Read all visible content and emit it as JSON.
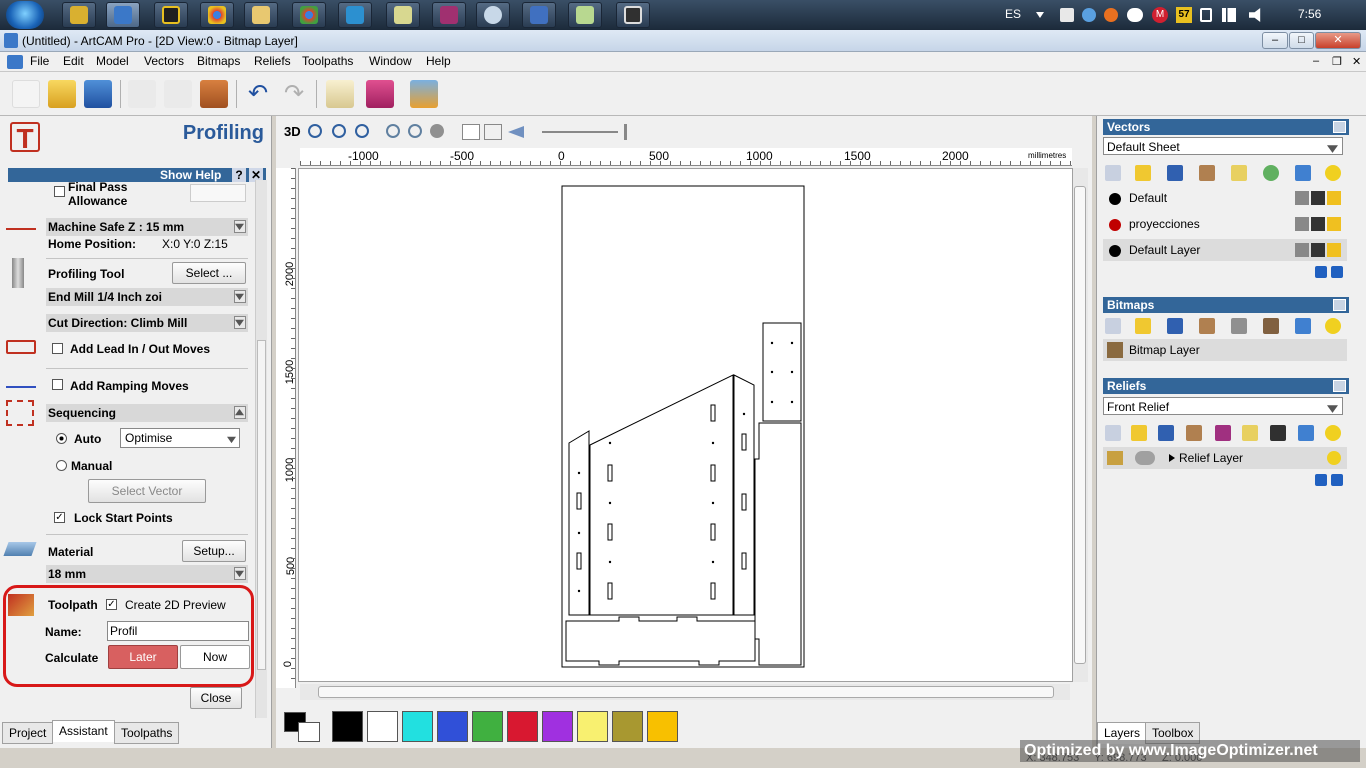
{
  "taskbar": {
    "lang": "ES",
    "clock": "7:56",
    "badge": "57"
  },
  "window": {
    "title": "(Untitled) - ArtCAM Pro - [2D View:0 - Bitmap Layer]",
    "min": "–",
    "max": "□",
    "close": "✕"
  },
  "menu": [
    "File",
    "Edit",
    "Model",
    "Vectors",
    "Bitmaps",
    "Reliefs",
    "Toolpaths",
    "Window",
    "Help"
  ],
  "left": {
    "title": "Profiling",
    "show_help": "Show Help",
    "help_q": "?",
    "help_x": "✕",
    "final_pass": "Final Pass",
    "allowance": "Allowance",
    "safe_z": "Machine Safe Z : 15 mm",
    "home_label": "Home Position:",
    "home_value": "X:0 Y:0 Z:15",
    "tool_label": "Profiling Tool",
    "select_btn": "Select ...",
    "tool_name": "End Mill 1/4 Inch zoi",
    "cut_dir": "Cut Direction: Climb Mill",
    "lead": "Add Lead In / Out Moves",
    "ramp": "Add Ramping Moves",
    "sequencing": "Sequencing",
    "auto": "Auto",
    "optimise": "Optimise",
    "manual": "Manual",
    "select_vector": "Select Vector",
    "lock_start": "Lock Start Points",
    "material": "Material",
    "setup": "Setup...",
    "thickness": "18 mm",
    "toolpath": "Toolpath",
    "preview": "Create 2D Preview",
    "name_label": "Name:",
    "name_value": "Profil",
    "calculate": "Calculate",
    "later": "Later",
    "now": "Now",
    "close": "Close",
    "tabs": [
      "Project",
      "Assistant",
      "Toolpaths"
    ]
  },
  "view": {
    "mode": "3D",
    "units": "millimetres",
    "hticks": [
      "-1000",
      "-500",
      "0",
      "500",
      "1000",
      "1500",
      "2000"
    ],
    "vticks": [
      "2000",
      "1500",
      "1000",
      "500",
      "0"
    ]
  },
  "right": {
    "vectors": "Vectors",
    "sheet": "Default Sheet",
    "layers": [
      "Default",
      "proyecciones",
      "Default Layer"
    ],
    "layer_colors": [
      "#000000",
      "#c00000",
      "#000000"
    ],
    "bitmaps": "Bitmaps",
    "bitmap_layer": "Bitmap Layer",
    "reliefs": "Reliefs",
    "front_relief": "Front Relief",
    "relief_layer": "Relief Layer",
    "tabs": [
      "Layers",
      "Toolbox"
    ]
  },
  "palette": [
    "#000000",
    "#ffffff",
    "#22e0e0",
    "#3050d8",
    "#40b040",
    "#d81830",
    "#a030e0",
    "#f8f070",
    "#a89830",
    "#f8c000"
  ],
  "status": {
    "x": "X: 348.753",
    "y": "Y: 698.773",
    "z": "Z: 0.000",
    "watermark": "Optimized by www.ImageOptimizer.net"
  }
}
